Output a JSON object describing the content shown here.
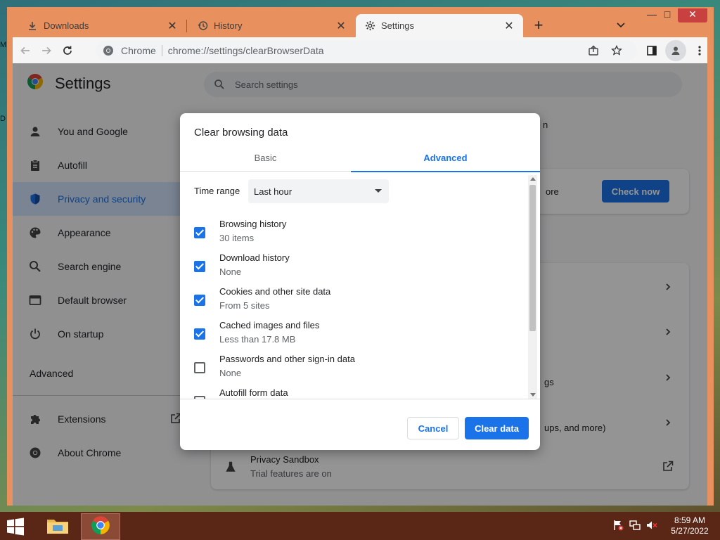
{
  "desktop": {
    "fragment_top": "M",
    "fragment_mid": "D"
  },
  "tabs": [
    {
      "label": "Downloads",
      "icon": "download-icon",
      "active": false
    },
    {
      "label": "History",
      "icon": "history-icon",
      "active": false
    },
    {
      "label": "Settings",
      "icon": "gear-icon",
      "active": true
    }
  ],
  "window_controls": {
    "minimize": "—",
    "maximize": "□",
    "close": "✕"
  },
  "omnibox": {
    "origin_label": "Chrome",
    "url": "chrome://settings/clearBrowserData"
  },
  "settings": {
    "title": "Settings",
    "search_placeholder": "Search settings",
    "nav": [
      {
        "label": "You and Google",
        "icon": "person-icon"
      },
      {
        "label": "Autofill",
        "icon": "clipboard-icon"
      },
      {
        "label": "Privacy and security",
        "icon": "shield-icon",
        "active": true
      },
      {
        "label": "Appearance",
        "icon": "palette-icon"
      },
      {
        "label": "Search engine",
        "icon": "search-icon"
      },
      {
        "label": "Default browser",
        "icon": "browser-icon"
      },
      {
        "label": "On startup",
        "icon": "power-icon"
      }
    ],
    "advanced_label": "Advanced",
    "extensions_label": "Extensions",
    "about_label": "About Chrome",
    "background": {
      "heading_fragment": "n",
      "safety_fragment": "ore",
      "check_now": "Check now",
      "row3_fragment": "gs",
      "row4_fragment": "ups, and more)",
      "privacy_sandbox_title": "Privacy Sandbox",
      "privacy_sandbox_sub": "Trial features are on"
    }
  },
  "dialog": {
    "title": "Clear browsing data",
    "tabs": [
      {
        "label": "Basic"
      },
      {
        "label": "Advanced",
        "selected": true
      }
    ],
    "time_range_label": "Time range",
    "time_range_value": "Last hour",
    "items": [
      {
        "label": "Browsing history",
        "sub": "30 items",
        "checked": true
      },
      {
        "label": "Download history",
        "sub": "None",
        "checked": true
      },
      {
        "label": "Cookies and other site data",
        "sub": "From 5 sites",
        "checked": true
      },
      {
        "label": "Cached images and files",
        "sub": "Less than 17.8 MB",
        "checked": true
      },
      {
        "label": "Passwords and other sign-in data",
        "sub": "None",
        "checked": false
      },
      {
        "label": "Autofill form data",
        "sub": "",
        "checked": false
      }
    ],
    "cancel_label": "Cancel",
    "clear_label": "Clear data"
  },
  "taskbar": {
    "time": "8:59 AM",
    "date": "5/27/2022"
  },
  "colors": {
    "accent": "#1a73e8",
    "window_frame": "#e8905e",
    "taskbar": "#5a2616"
  }
}
